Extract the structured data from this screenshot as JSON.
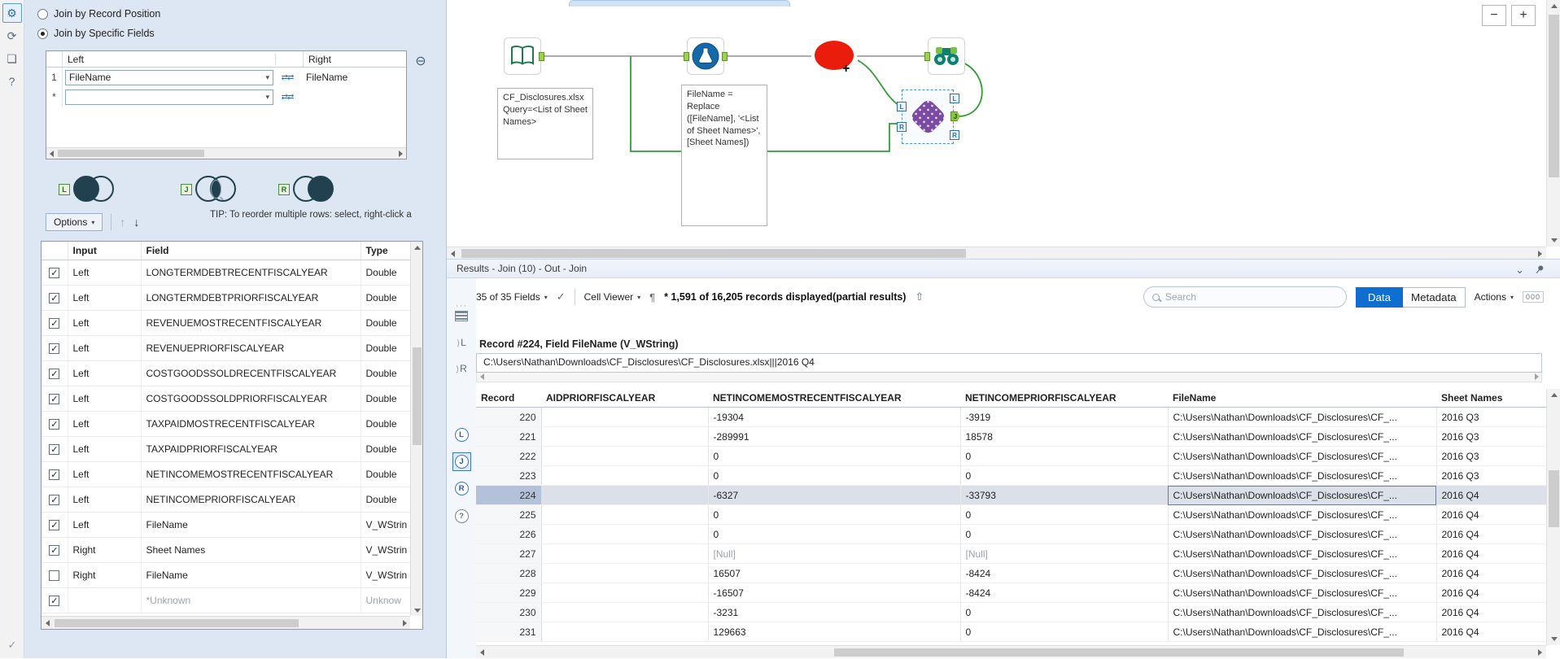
{
  "icons": {
    "gear": "⚙",
    "canvas_tab": "⟳",
    "tag": "❏",
    "help": "?",
    "check": "✓",
    "remove": "⊖",
    "swap": "⇄⇄",
    "up_arrow": "↑",
    "down_arrow": "↓",
    "pilcrow": "¶",
    "apply_check": "✓",
    "parse_up": "⇧",
    "collapse": "⌄",
    "zoom_out": "−",
    "zoom_in": "+"
  },
  "config": {
    "radio_position": "Join by Record Position",
    "radio_fields": "Join by Specific Fields",
    "join_by": {
      "left_header": "Left",
      "right_header": "Right",
      "rows": [
        {
          "num": "1",
          "left": "FileName",
          "right": "FileName"
        },
        {
          "num": "*",
          "left": "",
          "right": ""
        }
      ]
    },
    "venn": {
      "l": "L",
      "j": "J",
      "r": "R"
    },
    "options_label": "Options",
    "tip": "TIP: To reorder multiple rows: select, right-click a",
    "fields": {
      "headers": {
        "input": "Input",
        "field": "Field",
        "type": "Type"
      },
      "rows": [
        {
          "checked": true,
          "input": "Left",
          "field": "LONGTERMDEBTRECENTFISCALYEAR",
          "type": "Double"
        },
        {
          "checked": true,
          "input": "Left",
          "field": "LONGTERMDEBTPRIORFISCALYEAR",
          "type": "Double"
        },
        {
          "checked": true,
          "input": "Left",
          "field": "REVENUEMOSTRECENTFISCALYEAR",
          "type": "Double"
        },
        {
          "checked": true,
          "input": "Left",
          "field": "REVENUEPRIORFISCALYEAR",
          "type": "Double"
        },
        {
          "checked": true,
          "input": "Left",
          "field": "COSTGOODSSOLDRECENTFISCALYEAR",
          "type": "Double"
        },
        {
          "checked": true,
          "input": "Left",
          "field": "COSTGOODSSOLDPRIORFISCALYEAR",
          "type": "Double"
        },
        {
          "checked": true,
          "input": "Left",
          "field": "TAXPAIDMOSTRECENTFISCALYEAR",
          "type": "Double"
        },
        {
          "checked": true,
          "input": "Left",
          "field": "TAXPAIDPRIORFISCALYEAR",
          "type": "Double"
        },
        {
          "checked": true,
          "input": "Left",
          "field": "NETINCOMEMOSTRECENTFISCALYEAR",
          "type": "Double"
        },
        {
          "checked": true,
          "input": "Left",
          "field": "NETINCOMEPRIORFISCALYEAR",
          "type": "Double"
        },
        {
          "checked": true,
          "input": "Left",
          "field": "FileName",
          "type": "V_WStrin"
        },
        {
          "checked": true,
          "input": "Right",
          "field": "Sheet Names",
          "type": "V_WStrin"
        },
        {
          "checked": false,
          "input": "Right",
          "field": "FileName",
          "type": "V_WStrin"
        },
        {
          "checked": true,
          "input": "",
          "field": "*Unknown",
          "type": "Unknow",
          "dim": true
        }
      ]
    }
  },
  "canvas": {
    "input_annotation": "CF_Disclosures.xlsx\nQuery=<List of Sheet Names>",
    "formula_annotation": "FileName = Replace ([FileName], '<List of Sheet Names>', [Sheet Names])",
    "join_anchor_in_left": "L",
    "join_anchor_in_right": "R",
    "join_anchor_out_left": "L",
    "join_anchor_out_join": "J",
    "join_anchor_out_right": "R"
  },
  "results": {
    "title": "Results - Join (10) - Out - Join",
    "toolbar": {
      "fields": "35 of 35 Fields",
      "cell_viewer": "Cell Viewer",
      "records": "* 1,591 of 16,205 records displayed(partial results)",
      "search_placeholder": "Search",
      "data": "Data",
      "metadata": "Metadata",
      "actions": "Actions",
      "page": "000"
    },
    "cell_info": "Record #224, Field FileName (V_WString)",
    "cell_value": "C:\\Users\\Nathan\\Downloads\\CF_Disclosures\\CF_Disclosures.xlsx|||2016 Q4",
    "rail": {
      "in_l": "L",
      "in_r": "R",
      "out_l": "L",
      "out_j": "J",
      "out_r": "R",
      "help": "?"
    },
    "table": {
      "headers": [
        "Record",
        "AIDPRIORFISCALYEAR",
        "NETINCOMEMOSTRECENTFISCALYEAR",
        "NETINCOMEPRIORFISCALYEAR",
        "FileName",
        "Sheet Names"
      ],
      "rows": [
        {
          "record": "220",
          "paid": "",
          "net_recent": "-19304",
          "net_prior": "-3919",
          "file": "C:\\Users\\Nathan\\Downloads\\CF_Disclosures\\CF_...",
          "sheet": "2016 Q3"
        },
        {
          "record": "221",
          "paid": "",
          "net_recent": "-289991",
          "net_prior": "18578",
          "file": "C:\\Users\\Nathan\\Downloads\\CF_Disclosures\\CF_...",
          "sheet": "2016 Q3"
        },
        {
          "record": "222",
          "paid": "",
          "net_recent": "0",
          "net_prior": "0",
          "file": "C:\\Users\\Nathan\\Downloads\\CF_Disclosures\\CF_...",
          "sheet": "2016 Q3"
        },
        {
          "record": "223",
          "paid": "",
          "net_recent": "0",
          "net_prior": "0",
          "file": "C:\\Users\\Nathan\\Downloads\\CF_Disclosures\\CF_...",
          "sheet": "2016 Q3"
        },
        {
          "record": "224",
          "paid": "",
          "net_recent": "-6327",
          "net_prior": "-33793",
          "file": "C:\\Users\\Nathan\\Downloads\\CF_Disclosures\\CF_...",
          "sheet": "2016 Q4",
          "selected": true
        },
        {
          "record": "225",
          "paid": "",
          "net_recent": "0",
          "net_prior": "0",
          "file": "C:\\Users\\Nathan\\Downloads\\CF_Disclosures\\CF_...",
          "sheet": "2016 Q4"
        },
        {
          "record": "226",
          "paid": "",
          "net_recent": "0",
          "net_prior": "0",
          "file": "C:\\Users\\Nathan\\Downloads\\CF_Disclosures\\CF_...",
          "sheet": "2016 Q4"
        },
        {
          "record": "227",
          "paid": "",
          "net_recent": "[Null]",
          "net_prior": "[Null]",
          "file": "C:\\Users\\Nathan\\Downloads\\CF_Disclosures\\CF_...",
          "sheet": "2016 Q4",
          "nulls": true
        },
        {
          "record": "228",
          "paid": "",
          "net_recent": "16507",
          "net_prior": "-8424",
          "file": "C:\\Users\\Nathan\\Downloads\\CF_Disclosures\\CF_...",
          "sheet": "2016 Q4"
        },
        {
          "record": "229",
          "paid": "",
          "net_recent": "-16507",
          "net_prior": "-8424",
          "file": "C:\\Users\\Nathan\\Downloads\\CF_Disclosures\\CF_...",
          "sheet": "2016 Q4"
        },
        {
          "record": "230",
          "paid": "",
          "net_recent": "-3231",
          "net_prior": "0",
          "file": "C:\\Users\\Nathan\\Downloads\\CF_Disclosures\\CF_...",
          "sheet": "2016 Q4"
        },
        {
          "record": "231",
          "paid": "",
          "net_recent": "129663",
          "net_prior": "0",
          "file": "C:\\Users\\Nathan\\Downloads\\CF_Disclosures\\CF_...",
          "sheet": "2016 Q4"
        }
      ]
    }
  }
}
